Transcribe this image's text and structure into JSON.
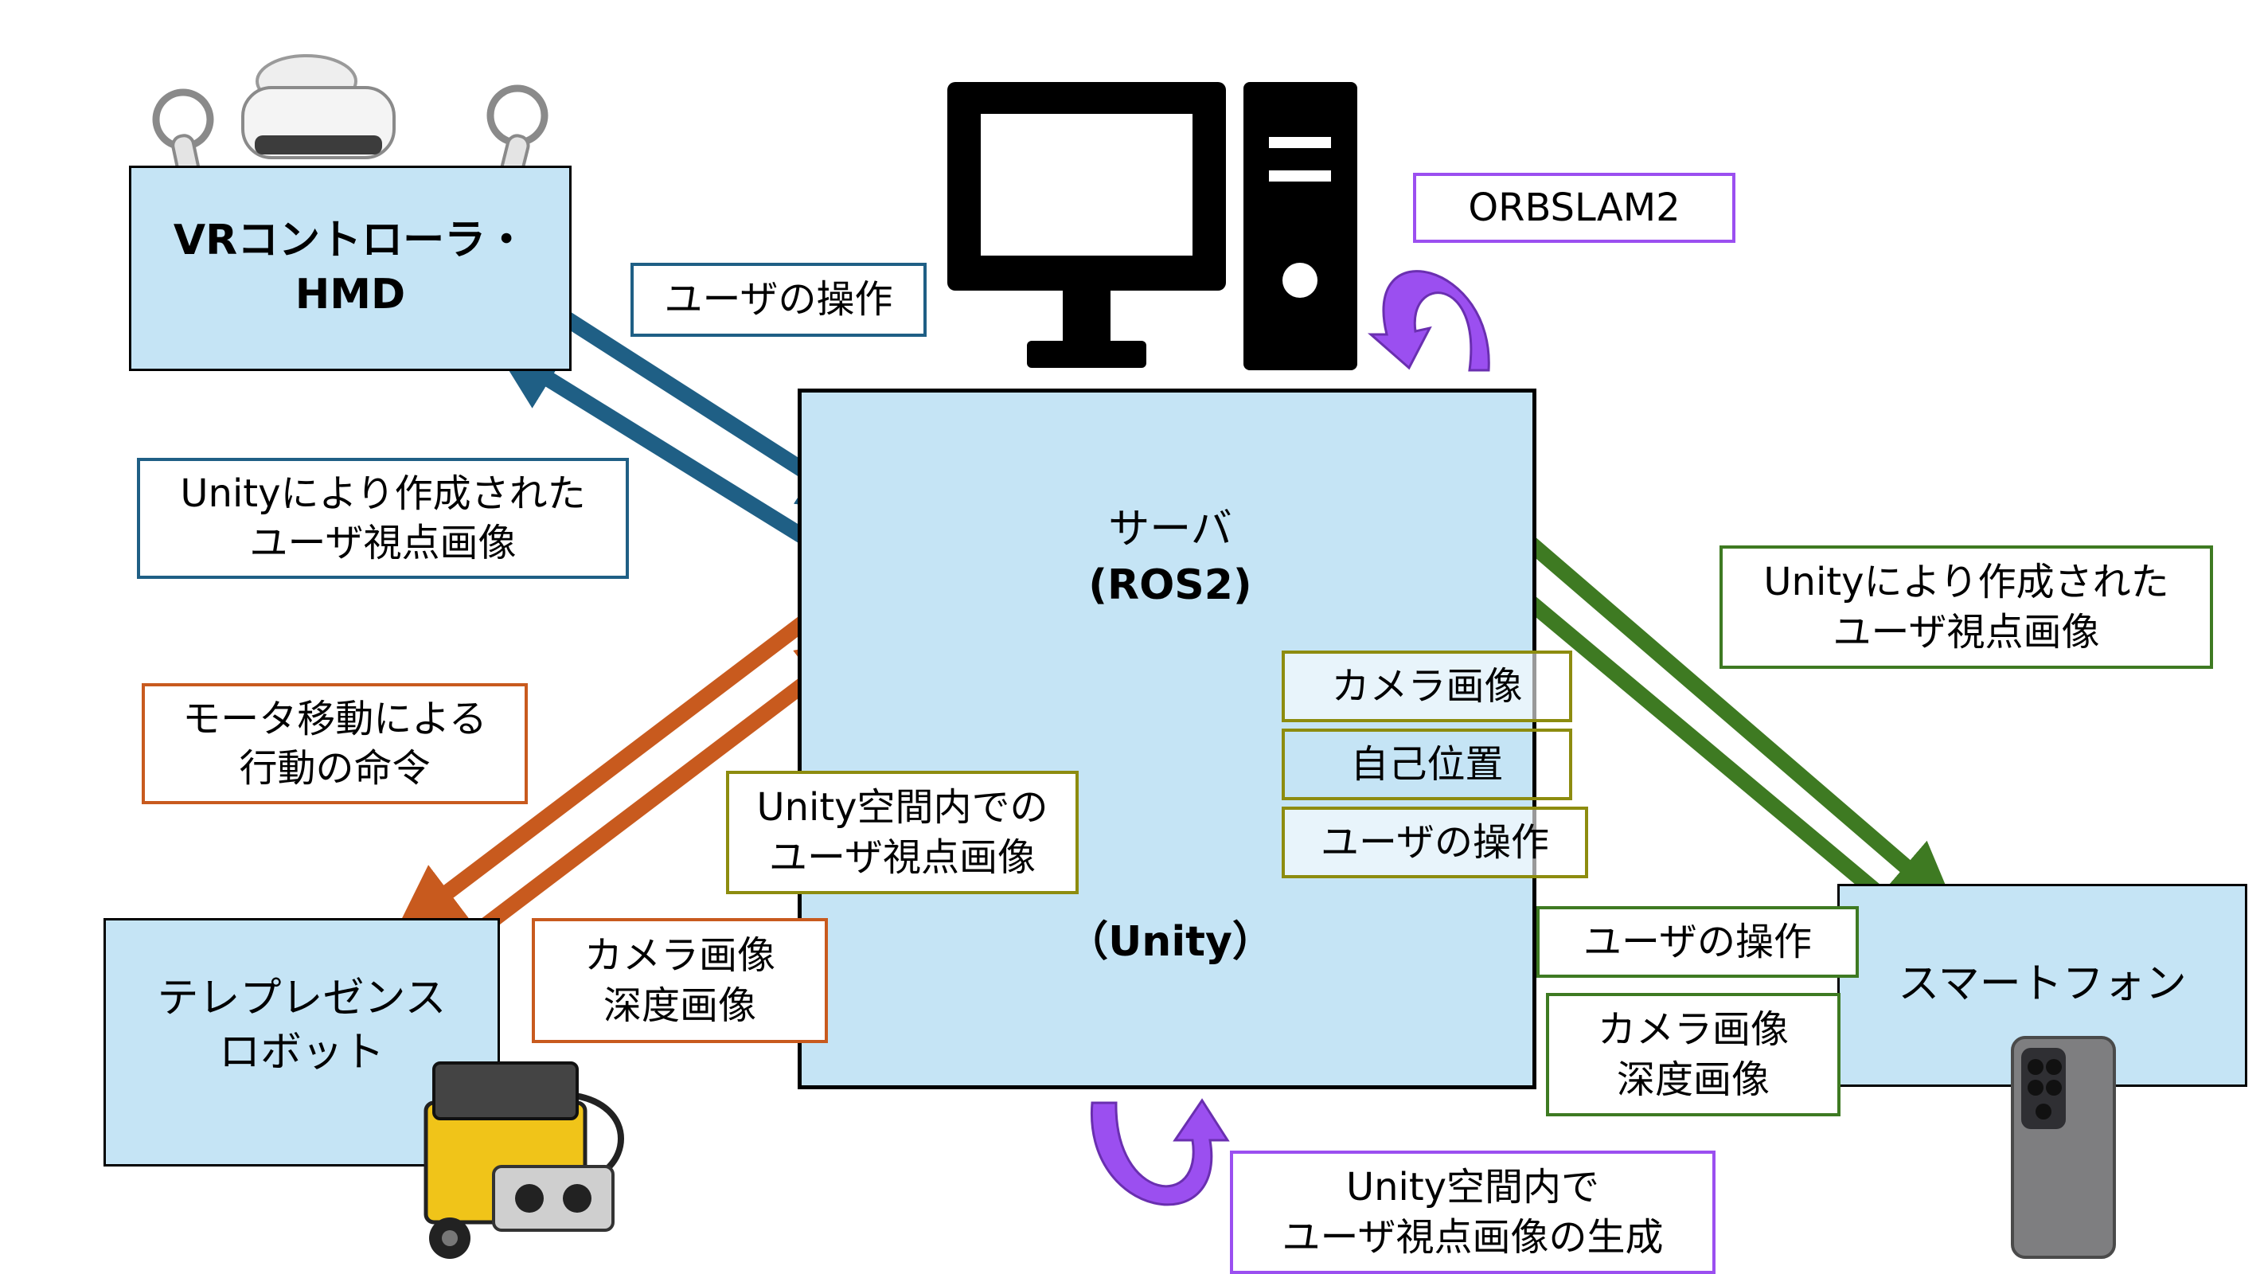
{
  "colors": {
    "node_fill": "#c5e4f5",
    "vr_blue": "#1f5f85",
    "robot_orange": "#c85a1e",
    "phone_green": "#3e7a22",
    "unity_olive": "#8d8c0f",
    "process_purple": "#9b4ff0",
    "black": "#000000"
  },
  "nodes": {
    "vr": {
      "line1": "VRコントローラ・",
      "line2": "HMD"
    },
    "server": {
      "line1": "サーバ",
      "line2": "(ROS2)",
      "line3": "（Unity）"
    },
    "robot": {
      "line1": "テレプレゼンス",
      "line2": "ロボット"
    },
    "phone": {
      "line1": "スマートフォン"
    }
  },
  "labels": {
    "vr_op": "ユーザの操作",
    "vr_view": {
      "line1": "Unityにより作成された",
      "line2": "ユーザ視点画像"
    },
    "orbslam": "ORBSLAM2",
    "robot_cmd": {
      "line1": "モータ移動による",
      "line2": "行動の命令"
    },
    "robot_cam": {
      "line1": "カメラ画像",
      "line2": "深度画像"
    },
    "unity_view": {
      "line1": "Unity空間内での",
      "line2": "ユーザ視点画像"
    },
    "down_cam": "カメラ画像",
    "down_pose": "自己位置",
    "down_op": "ユーザの操作",
    "phone_view": {
      "line1": "Unityにより作成された",
      "line2": "ユーザ視点画像"
    },
    "phone_op": "ユーザの操作",
    "phone_cam": {
      "line1": "カメラ画像",
      "line2": "深度画像"
    },
    "unity_gen": {
      "line1": "Unity空間内で",
      "line2": "ユーザ視点画像の生成"
    }
  },
  "icons": {
    "pc": "desktop-computer-icon",
    "headset": "vr-headset-icon",
    "robot": "robot-photo-icon",
    "phone": "smartphone-photo-icon"
  }
}
